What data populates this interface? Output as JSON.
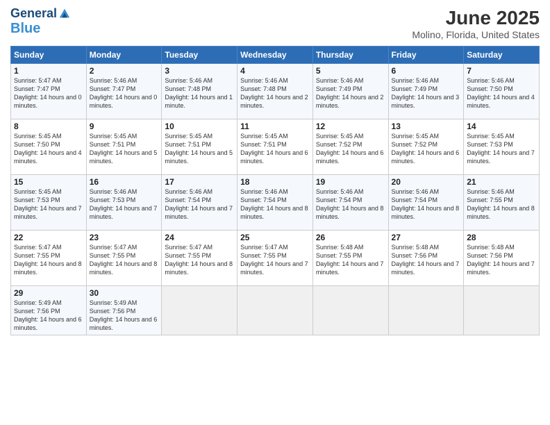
{
  "logo": {
    "line1": "General",
    "line2": "Blue"
  },
  "title": "June 2025",
  "subtitle": "Molino, Florida, United States",
  "days_of_week": [
    "Sunday",
    "Monday",
    "Tuesday",
    "Wednesday",
    "Thursday",
    "Friday",
    "Saturday"
  ],
  "weeks": [
    [
      {
        "day": "1",
        "sunrise": "5:47 AM",
        "sunset": "7:47 PM",
        "daylight": "14 hours and 0 minutes."
      },
      {
        "day": "2",
        "sunrise": "5:46 AM",
        "sunset": "7:47 PM",
        "daylight": "14 hours and 0 minutes."
      },
      {
        "day": "3",
        "sunrise": "5:46 AM",
        "sunset": "7:48 PM",
        "daylight": "14 hours and 1 minute."
      },
      {
        "day": "4",
        "sunrise": "5:46 AM",
        "sunset": "7:48 PM",
        "daylight": "14 hours and 2 minutes."
      },
      {
        "day": "5",
        "sunrise": "5:46 AM",
        "sunset": "7:49 PM",
        "daylight": "14 hours and 2 minutes."
      },
      {
        "day": "6",
        "sunrise": "5:46 AM",
        "sunset": "7:49 PM",
        "daylight": "14 hours and 3 minutes."
      },
      {
        "day": "7",
        "sunrise": "5:46 AM",
        "sunset": "7:50 PM",
        "daylight": "14 hours and 4 minutes."
      }
    ],
    [
      {
        "day": "8",
        "sunrise": "5:45 AM",
        "sunset": "7:50 PM",
        "daylight": "14 hours and 4 minutes."
      },
      {
        "day": "9",
        "sunrise": "5:45 AM",
        "sunset": "7:51 PM",
        "daylight": "14 hours and 5 minutes."
      },
      {
        "day": "10",
        "sunrise": "5:45 AM",
        "sunset": "7:51 PM",
        "daylight": "14 hours and 5 minutes."
      },
      {
        "day": "11",
        "sunrise": "5:45 AM",
        "sunset": "7:51 PM",
        "daylight": "14 hours and 6 minutes."
      },
      {
        "day": "12",
        "sunrise": "5:45 AM",
        "sunset": "7:52 PM",
        "daylight": "14 hours and 6 minutes."
      },
      {
        "day": "13",
        "sunrise": "5:45 AM",
        "sunset": "7:52 PM",
        "daylight": "14 hours and 6 minutes."
      },
      {
        "day": "14",
        "sunrise": "5:45 AM",
        "sunset": "7:53 PM",
        "daylight": "14 hours and 7 minutes."
      }
    ],
    [
      {
        "day": "15",
        "sunrise": "5:45 AM",
        "sunset": "7:53 PM",
        "daylight": "14 hours and 7 minutes."
      },
      {
        "day": "16",
        "sunrise": "5:46 AM",
        "sunset": "7:53 PM",
        "daylight": "14 hours and 7 minutes."
      },
      {
        "day": "17",
        "sunrise": "5:46 AM",
        "sunset": "7:54 PM",
        "daylight": "14 hours and 7 minutes."
      },
      {
        "day": "18",
        "sunrise": "5:46 AM",
        "sunset": "7:54 PM",
        "daylight": "14 hours and 8 minutes."
      },
      {
        "day": "19",
        "sunrise": "5:46 AM",
        "sunset": "7:54 PM",
        "daylight": "14 hours and 8 minutes."
      },
      {
        "day": "20",
        "sunrise": "5:46 AM",
        "sunset": "7:54 PM",
        "daylight": "14 hours and 8 minutes."
      },
      {
        "day": "21",
        "sunrise": "5:46 AM",
        "sunset": "7:55 PM",
        "daylight": "14 hours and 8 minutes."
      }
    ],
    [
      {
        "day": "22",
        "sunrise": "5:47 AM",
        "sunset": "7:55 PM",
        "daylight": "14 hours and 8 minutes."
      },
      {
        "day": "23",
        "sunrise": "5:47 AM",
        "sunset": "7:55 PM",
        "daylight": "14 hours and 8 minutes."
      },
      {
        "day": "24",
        "sunrise": "5:47 AM",
        "sunset": "7:55 PM",
        "daylight": "14 hours and 8 minutes."
      },
      {
        "day": "25",
        "sunrise": "5:47 AM",
        "sunset": "7:55 PM",
        "daylight": "14 hours and 7 minutes."
      },
      {
        "day": "26",
        "sunrise": "5:48 AM",
        "sunset": "7:55 PM",
        "daylight": "14 hours and 7 minutes."
      },
      {
        "day": "27",
        "sunrise": "5:48 AM",
        "sunset": "7:56 PM",
        "daylight": "14 hours and 7 minutes."
      },
      {
        "day": "28",
        "sunrise": "5:48 AM",
        "sunset": "7:56 PM",
        "daylight": "14 hours and 7 minutes."
      }
    ],
    [
      {
        "day": "29",
        "sunrise": "5:49 AM",
        "sunset": "7:56 PM",
        "daylight": "14 hours and 6 minutes."
      },
      {
        "day": "30",
        "sunrise": "5:49 AM",
        "sunset": "7:56 PM",
        "daylight": "14 hours and 6 minutes."
      },
      null,
      null,
      null,
      null,
      null
    ]
  ]
}
